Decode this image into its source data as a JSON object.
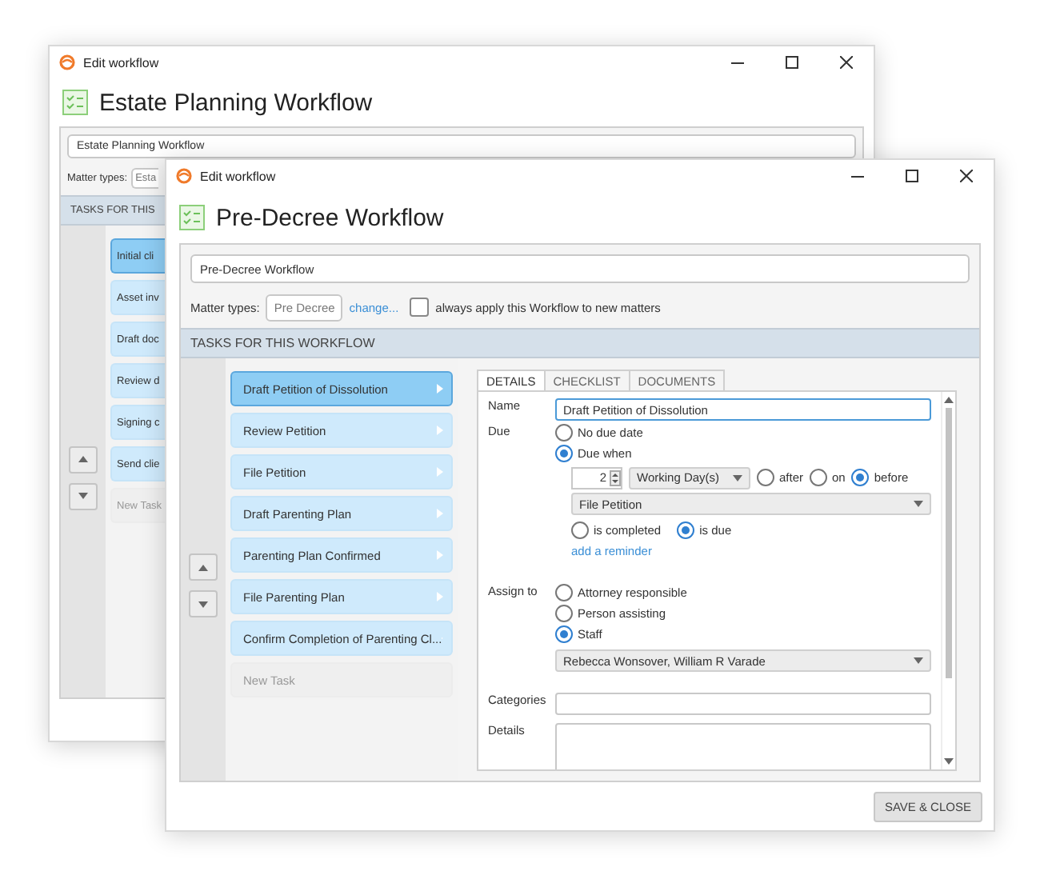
{
  "background_window": {
    "title": "Edit workflow",
    "heading": "Estate Planning Workflow",
    "name_value": "Estate Planning Workflow",
    "matter_types_label": "Matter types:",
    "matter_type": "Esta",
    "tasks_header": "TASKS FOR THIS",
    "tasks": [
      {
        "label": "Initial cli",
        "selected": true,
        "kind": "task"
      },
      {
        "label": "Asset inv",
        "selected": false,
        "kind": "task"
      },
      {
        "label": "Draft doc",
        "selected": false,
        "kind": "task"
      },
      {
        "label": "Review d",
        "selected": false,
        "kind": "task"
      },
      {
        "label": "Signing c",
        "selected": false,
        "kind": "task"
      },
      {
        "label": "Send clie",
        "selected": false,
        "kind": "task"
      },
      {
        "label": "New Task",
        "selected": false,
        "kind": "new"
      }
    ]
  },
  "window": {
    "title": "Edit workflow",
    "heading": "Pre-Decree Workflow",
    "name_value": "Pre-Decree Workflow",
    "matter_types_label": "Matter types:",
    "matter_type": "Pre Decree",
    "change_link": "change...",
    "apply_checkbox": {
      "label": "always apply this Workflow to new matters",
      "checked": false
    },
    "tasks_header": "TASKS FOR THIS WORKFLOW",
    "tasks": [
      {
        "label": "Draft Petition of Dissolution",
        "selected": true,
        "kind": "task"
      },
      {
        "label": "Review Petition",
        "selected": false,
        "kind": "task"
      },
      {
        "label": "File Petition",
        "selected": false,
        "kind": "task"
      },
      {
        "label": "Draft Parenting Plan",
        "selected": false,
        "kind": "task"
      },
      {
        "label": "Parenting Plan Confirmed",
        "selected": false,
        "kind": "task"
      },
      {
        "label": "File Parenting Plan",
        "selected": false,
        "kind": "task"
      },
      {
        "label": "Confirm Completion of Parenting Cl...",
        "selected": false,
        "kind": "task"
      },
      {
        "label": "New Task",
        "selected": false,
        "kind": "new"
      }
    ],
    "detail_tabs": [
      {
        "label": "DETAILS",
        "selected": true
      },
      {
        "label": "CHECKLIST",
        "selected": false
      },
      {
        "label": "DOCUMENTS",
        "selected": false
      }
    ],
    "details": {
      "name_label": "Name",
      "name_value": "Draft Petition of Dissolution",
      "due_label": "Due",
      "due_options": [
        {
          "label": "No due date",
          "selected": false
        },
        {
          "label": "Due when",
          "selected": true
        }
      ],
      "count": "2",
      "unit": "Working Day(s)",
      "relation_options": [
        {
          "label": "after",
          "selected": false
        },
        {
          "label": "on",
          "selected": false
        },
        {
          "label": "before",
          "selected": true
        }
      ],
      "reference_task": "File Petition",
      "condition_options": [
        {
          "label": "is completed",
          "selected": false
        },
        {
          "label": "is due",
          "selected": true
        }
      ],
      "reminder_link": "add a reminder",
      "assign_label": "Assign to",
      "assign_options": [
        {
          "label": "Attorney responsible",
          "selected": false
        },
        {
          "label": "Person assisting",
          "selected": false
        },
        {
          "label": "Staff",
          "selected": true
        }
      ],
      "staff": "Rebecca Wonsover, William R Varade",
      "categories_label": "Categories",
      "details_label": "Details"
    },
    "save_button": "SAVE & CLOSE"
  }
}
